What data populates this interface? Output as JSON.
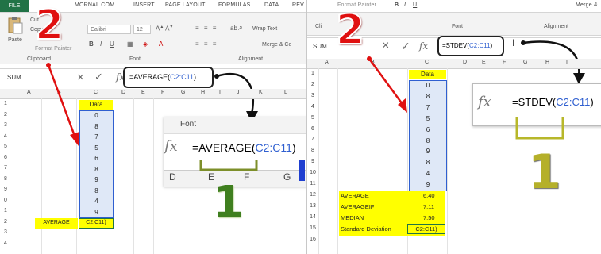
{
  "left": {
    "file_tab": "FILE",
    "tabs": [
      "MORNAL.COM",
      "INSERT",
      "PAGE LAYOUT",
      "FORMULAS",
      "DATA",
      "REV"
    ],
    "clipboard": {
      "paste": "Paste",
      "cut": "Cut",
      "copy": "Copy",
      "format_painter": "Format Painter",
      "group_label": "Clipboard"
    },
    "font": {
      "name": "Calibri",
      "size": "12",
      "group_label": "Font"
    },
    "alignment": {
      "wrap_text": "Wrap Text",
      "merge": "Merge & Ce",
      "group_label": "Alignment"
    },
    "name_box": "SUM",
    "formula": {
      "prefix": "=AVERAGE(",
      "ref": "C2:C11",
      "suffix": ")"
    },
    "columns": [
      "A",
      "B",
      "C",
      "D",
      "E",
      "F",
      "G",
      "H",
      "I",
      "J",
      "K",
      "L"
    ],
    "row_numbers": [
      "1",
      "2",
      "3",
      "4",
      "5",
      "6",
      "7",
      "8",
      "9",
      "0",
      "1",
      "2",
      "3",
      "4"
    ],
    "data_header": "Data",
    "data_values": [
      "0",
      "8",
      "7",
      "5",
      "6",
      "8",
      "9",
      "8",
      "4",
      "9"
    ],
    "average_label": "AVERAGE",
    "average_edit": "C2:C11)",
    "zoom": {
      "title": "Font",
      "formula_prefix": "=AVERAGE(",
      "formula_ref": "C2:C11",
      "formula_suffix": ")",
      "cols": [
        "D",
        "E",
        "F",
        "G"
      ]
    },
    "step_big": "2",
    "step_small": "1"
  },
  "right": {
    "tabs": [
      "Format Painter",
      "B",
      "I",
      "U",
      "Merge &"
    ],
    "group_labels": {
      "clipboard": "Cli",
      "font": "Font",
      "alignment": "Alignment"
    },
    "name_box": "SUM",
    "formula": {
      "prefix": "=STDEV(",
      "ref": "C2:C11",
      "suffix": ")"
    },
    "columns": [
      "A",
      "B",
      "C",
      "D",
      "E",
      "F",
      "G",
      "H",
      "I"
    ],
    "row_numbers": [
      "1",
      "2",
      "3",
      "4",
      "5",
      "6",
      "7",
      "8",
      "9",
      "10",
      "11",
      "12",
      "13",
      "14",
      "15",
      "16"
    ],
    "data_header": "Data",
    "data_values": [
      "0",
      "8",
      "7",
      "5",
      "6",
      "8",
      "9",
      "8",
      "4",
      "9"
    ],
    "stats": [
      {
        "label": "AVERAGE",
        "value": "6.40"
      },
      {
        "label": "AVERAGEIF",
        "value": "7.11"
      },
      {
        "label": "MEDIAN",
        "value": "7.50"
      },
      {
        "label": "Standard Deviation",
        "value": "C2:C11)"
      }
    ],
    "zoom": {
      "formula_prefix": "=STDEV(",
      "formula_ref": "C2:C11",
      "formula_suffix": ")"
    },
    "step_big": "2",
    "step_small": "1"
  },
  "colors": {
    "excel_green": "#217346",
    "highlight": "#ffff00",
    "ref_blue": "#2f5fd0",
    "arrow_red": "#e01010",
    "step_green": "#3f7f1f"
  },
  "icons": {
    "fx": "fx",
    "cancel": "×",
    "enter": "✓"
  }
}
